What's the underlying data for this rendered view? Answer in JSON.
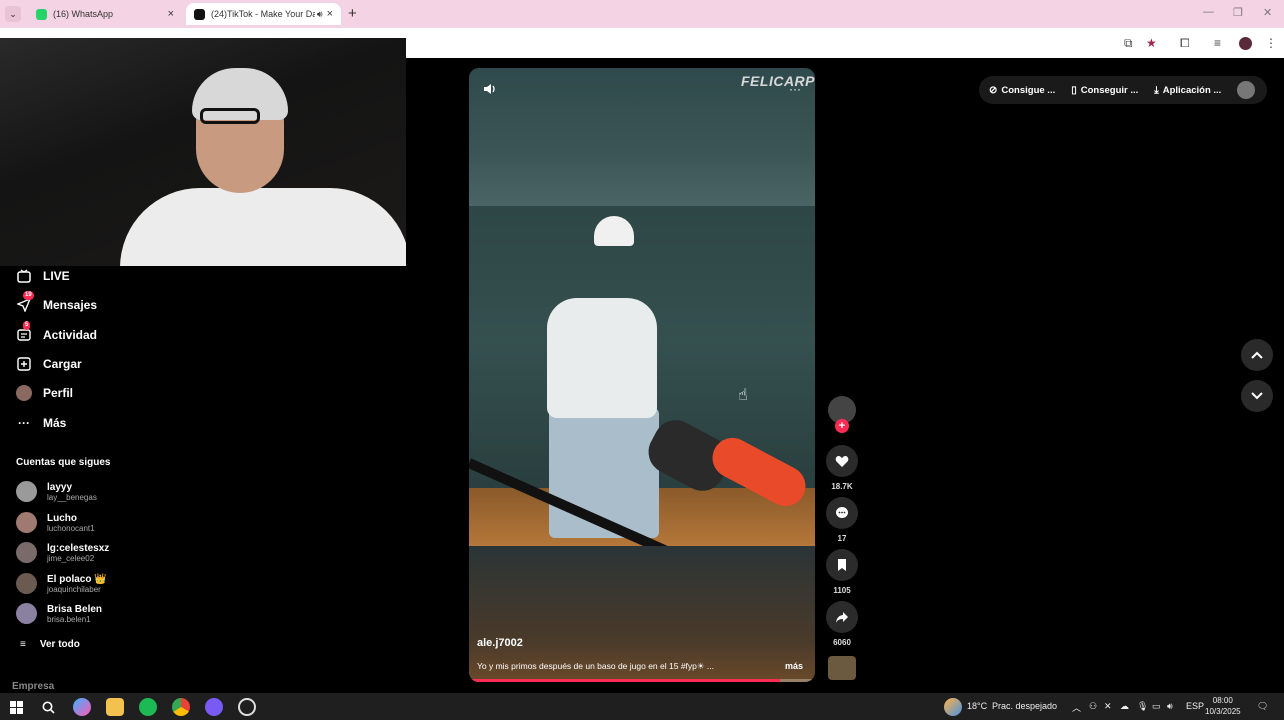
{
  "browser": {
    "tabs": [
      {
        "title": "(16) WhatsApp",
        "favicon_color": "#25d366"
      },
      {
        "title": "(24)TikTok - Make Your Day",
        "favicon_color": "#111111",
        "audio_icon": "speaker-icon"
      }
    ],
    "new_tab_label": "+",
    "tab_close_label": "×"
  },
  "sidebar": {
    "items": [
      {
        "label": "LIVE",
        "icon": "live-tv-icon"
      },
      {
        "label": "Mensajes",
        "icon": "paper-plane-icon",
        "badge": "19"
      },
      {
        "label": "Actividad",
        "icon": "activity-inbox-icon",
        "badge": "5"
      },
      {
        "label": "Cargar",
        "icon": "upload-plus-icon"
      },
      {
        "label": "Perfil",
        "icon": "avatar"
      },
      {
        "label": "Más",
        "icon": "more-dots-icon"
      }
    ],
    "following_title": "Cuentas que sigues",
    "following": [
      {
        "name": "layyy",
        "handle": "lay__benegas"
      },
      {
        "name": "Lucho",
        "handle": "luchonocant1"
      },
      {
        "name": "lg:celestesxz",
        "handle": "jime_celee02"
      },
      {
        "name": "El polaco 👑",
        "handle": "joaquinchilaber"
      },
      {
        "name": "Brisa Belen",
        "handle": "brisa.belen1"
      }
    ],
    "see_all": "Ver todo",
    "footer": "Empresa"
  },
  "video": {
    "brand_watermark": "FELICARP",
    "author": "ale.j7002",
    "caption": "Yo y mis primos después de un baso de jugo en el 15 #fyp☀ ...",
    "caption_more": "más",
    "progress": 0.9
  },
  "actions": {
    "likes": "18.7K",
    "comments": "17",
    "saves": "1105",
    "shares": "6060"
  },
  "topbar": {
    "items": [
      "Consigue ...",
      "Conseguir ...",
      "Aplicación ..."
    ]
  },
  "taskbar": {
    "weather_temp": "18°C",
    "weather_desc": "Prac. despejado",
    "lang": "ESP",
    "time": "08:00",
    "date": "10/3/2025"
  },
  "colors": {
    "accent": "#fe2c55",
    "tabbar_bg": "#f4d3e4",
    "taskbar_bg": "#1f1f1f"
  }
}
